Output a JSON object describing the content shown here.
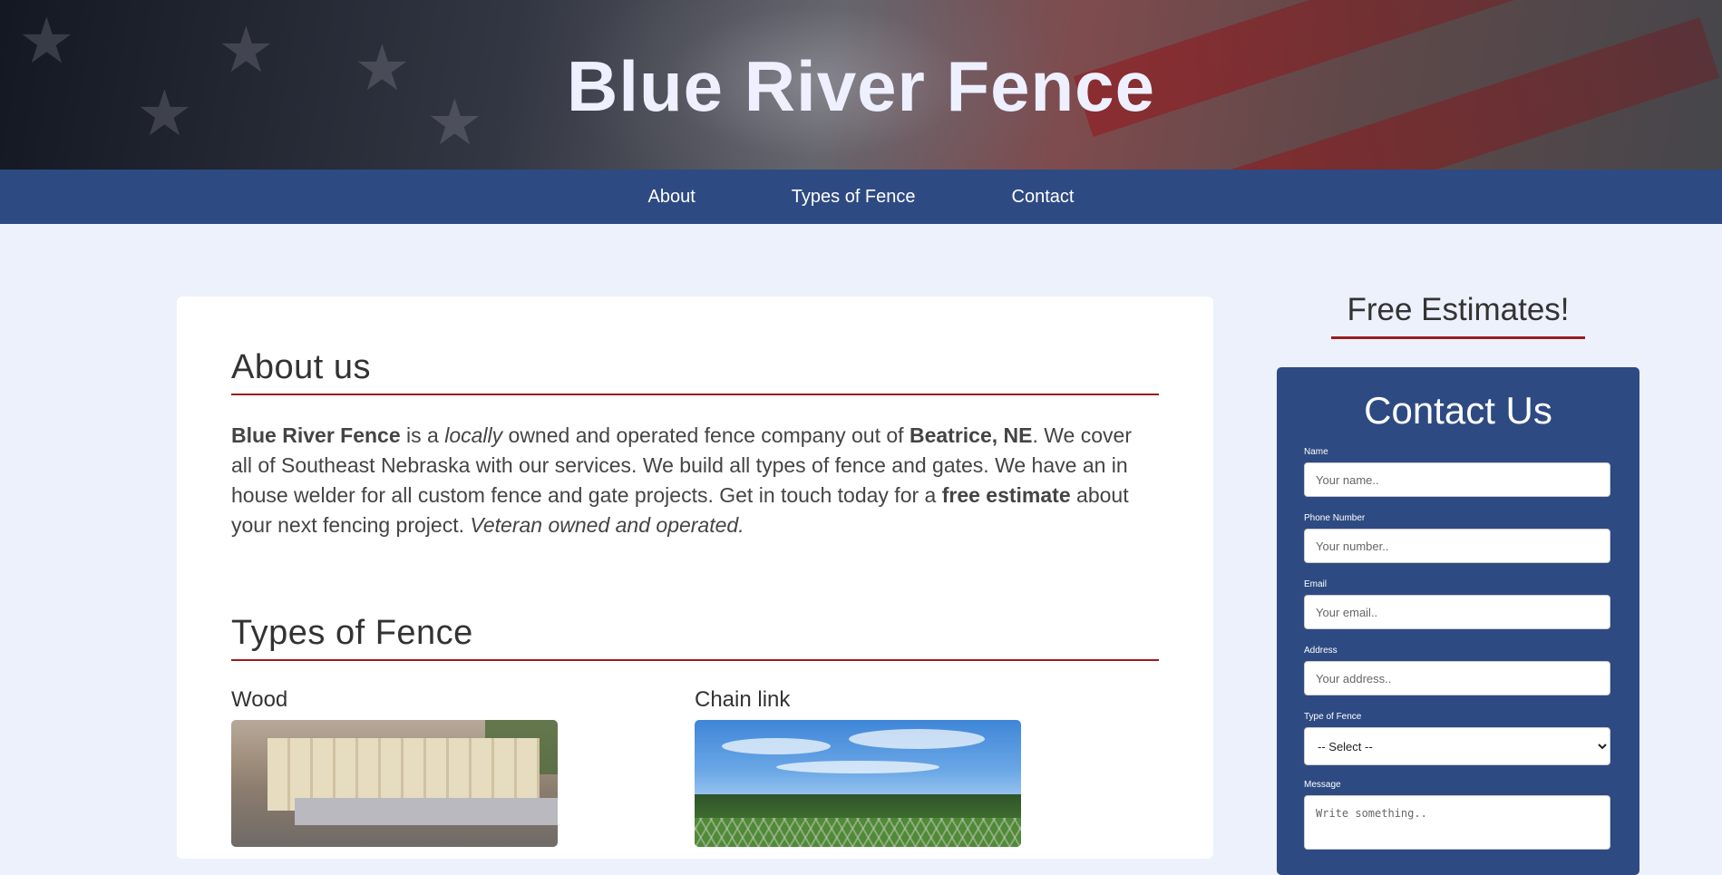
{
  "header": {
    "title": "Blue River Fence"
  },
  "nav": {
    "items": [
      "About",
      "Types of Fence",
      "Contact"
    ]
  },
  "about": {
    "heading": "About us",
    "parts": {
      "p1": "Blue River Fence",
      "p2": " is a ",
      "p3": "locally",
      "p4": " owned and operated fence company out of ",
      "p5": "Beatrice, NE",
      "p6": ". We cover all of Southeast Nebraska with our services. We build all types of fence and gates. We have an in house welder for all custom fence and gate projects. Get in touch today for a ",
      "p7": "free estimate",
      "p8": " about your next fencing project. ",
      "p9": "Veteran owned and operated."
    }
  },
  "types": {
    "heading": "Types of Fence",
    "items": [
      {
        "title": "Wood"
      },
      {
        "title": "Chain link"
      }
    ]
  },
  "sidebar": {
    "estimates": "Free Estimates!",
    "form": {
      "title": "Contact Us",
      "name_label": "Name",
      "name_placeholder": "Your name..",
      "phone_label": "Phone Number",
      "phone_placeholder": "Your number..",
      "email_label": "Email",
      "email_placeholder": "Your email..",
      "address_label": "Address",
      "address_placeholder": "Your address..",
      "type_label": "Type of Fence",
      "type_selected": "-- Select --",
      "message_label": "Message",
      "message_placeholder": "Write something.."
    }
  },
  "colors": {
    "nav": "#2e4a82",
    "accent_rule": "#9b1c1c",
    "page_bg": "#ecf1fc"
  }
}
